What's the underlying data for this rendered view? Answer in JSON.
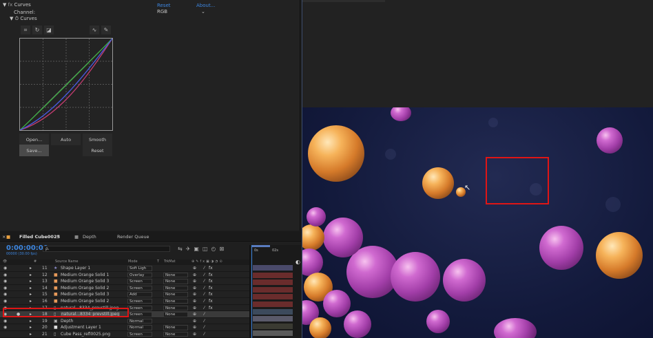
{
  "effect_controls": {
    "reset": "Reset",
    "about": "About...",
    "effect_name": "Curves",
    "channel_label": "Channel:",
    "channel_value": "RGB",
    "curves_label": "Curves",
    "buttons": {
      "open": "Open...",
      "auto": "Auto",
      "smooth": "Smooth",
      "save": "Save...",
      "reset": "Reset"
    },
    "colors": {
      "red_curve": "#c23c6e",
      "green_curve": "#3cb043",
      "blue_curve": "#4a5ae0",
      "accent": "#3d86e0"
    }
  },
  "timeline": {
    "tabs": [
      "Filled Cube0025",
      "Depth",
      "Render Queue"
    ],
    "timecode": "0:00:00:00",
    "fps": "00000 (30.00 fps)",
    "search_placeholder": "ρ.",
    "columns": {
      "num": "#",
      "source": "Source Name",
      "mode": "Mode",
      "t": "T",
      "trkmat": "TrkMat"
    },
    "ruler": {
      "start": "0s",
      "mid": "02s"
    },
    "layers": [
      {
        "num": "11",
        "name": "Shape Layer 1",
        "mode": "Soft Ligh",
        "trkmat": "",
        "color": "#8f8fcf",
        "icon": "star"
      },
      {
        "num": "12",
        "name": "Medium Orange Solid 1",
        "mode": "Overlay",
        "trkmat": "None",
        "color": "#e89a5a",
        "icon": "solid"
      },
      {
        "num": "13",
        "name": "Medium Orange Solid 3",
        "mode": "Screen",
        "trkmat": "None",
        "color": "#e89a5a",
        "icon": "solid"
      },
      {
        "num": "14",
        "name": "Medium Orange Solid 2",
        "mode": "Screen",
        "trkmat": "None",
        "color": "#e89a5a",
        "icon": "solid"
      },
      {
        "num": "15",
        "name": "Medium Orange Solid 3",
        "mode": "Add",
        "trkmat": "None",
        "color": "#e89a5a",
        "icon": "solid"
      },
      {
        "num": "16",
        "name": "Medium Orange Solid 2",
        "mode": "Screen",
        "trkmat": "None",
        "color": "#e89a5a",
        "icon": "solid"
      },
      {
        "num": "17",
        "name": "natural...8334_prevstill.jpeg",
        "mode": "Screen",
        "trkmat": "None",
        "color": "#b7b7b7",
        "icon": "file"
      },
      {
        "num": "18",
        "name": "natural...8334_prevstill.jpeg",
        "mode": "Screen",
        "trkmat": "None",
        "color": "#b7b7b7",
        "icon": "file"
      },
      {
        "num": "19",
        "name": "Depth",
        "mode": "Normal",
        "trkmat": "",
        "color": "#b7b7b7",
        "icon": "comp"
      },
      {
        "num": "20",
        "name": "Adjustment Layer 1",
        "mode": "Normal",
        "trkmat": "None",
        "color": "#e0e0e0",
        "icon": "solid"
      },
      {
        "num": "21",
        "name": "Cube Pass_refl0025.png",
        "mode": "Screen",
        "trkmat": "None",
        "color": "#b7b7b7",
        "icon": "file"
      }
    ]
  }
}
